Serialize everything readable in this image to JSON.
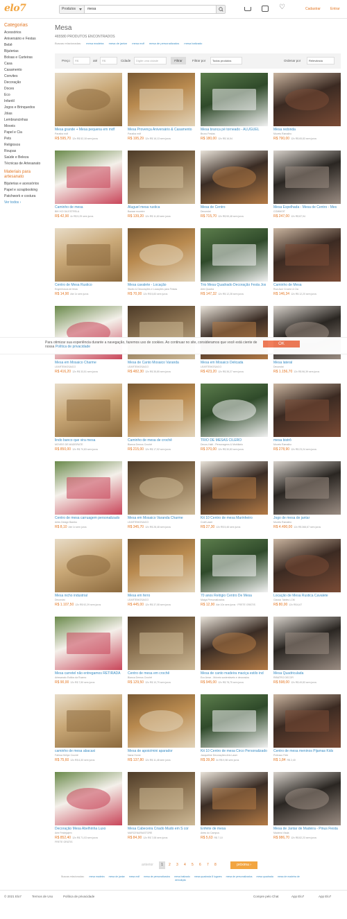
{
  "header": {
    "logo": "elo7",
    "search_category": "Produtos",
    "search_value": "mesa",
    "cadastrar": "Cadastrar",
    "entrar": "Entrar"
  },
  "sidebar": {
    "categories_title": "Categorias",
    "categories": [
      "Acessórios",
      "Aniversário e Festas",
      "Bebê",
      "Bijuterias",
      "Bolsas e Carteiras",
      "Casa",
      "Casamento",
      "Convites",
      "Decoração",
      "Doces",
      "Eco",
      "Infantil",
      "Jogos e Brinquedos",
      "Jóias",
      "Lembrancinhas",
      "Moveis",
      "Papel e Cia",
      "Pets",
      "Religiosos",
      "Roupas",
      "Saúde e Beleza",
      "Técnicas de Artesanato"
    ],
    "materials_title": "Materiais para artesanato",
    "materials": [
      "Bijuterias e acessórios",
      "Papel e scrapbooking",
      "Patchwork e costura"
    ],
    "see_all": "Ver todos ›"
  },
  "main": {
    "title": "Mesa",
    "count": "465580 PRODUTOS ENCONTRADOS",
    "related_tags_label": "Buscas relacionadas:",
    "tags": [
      "mesa madeira",
      "mesa de jantar",
      "mesa mdf",
      "mesa de personalizados",
      "mesa batizado"
    ]
  },
  "filters": {
    "preco": "Preço",
    "de_placeholder": "R$",
    "ate": "até",
    "ate_placeholder": "R$",
    "cidade": "Cidade",
    "cidade_placeholder": "Digite uma cidade",
    "filtrar": "Filtrar",
    "filtrar_por": "Filtrar por",
    "todos": "Todos produtos",
    "ordenar_por": "Ordenar por",
    "relevancia": "Relevância"
  },
  "products": [
    {
      "t": "Mesa grande + Mesa pequena em mdf",
      "s": "Paraiba mdf",
      "p": "R$ 595,70",
      "i": "12x R$ 52,18 sem juros"
    },
    {
      "t": "Mesa Provença Aniversário & Casamento",
      "s": "Paraíba mdf",
      "p": "R$ 195,29",
      "i": "12x R$ 16,13 sem juros"
    },
    {
      "t": "Mesa branca pé torneado - ALUGUEL",
      "s": "Bruno Festas",
      "p": "R$ 180,00",
      "i": "12x R$ 16,54"
    },
    {
      "t": "Mesa redonda",
      "s": "Moveis Ramalho",
      "p": "R$ 790,00",
      "i": "12x R$ 65,83 sem juros"
    },
    {
      "t": "Caminho de mesa",
      "s": "BIKI KO DA ESTRELA",
      "p": "R$ 42,90",
      "i": "4x R$ 5,29 sem juros"
    },
    {
      "t": "Aluguel mesa rustica",
      "s": "Bazaar moveire",
      "p": "R$ 139,20",
      "i": "12x R$ 11,60 sem juros"
    },
    {
      "t": "Mesa de Centro",
      "s": "Decorsist",
      "p": "R$ 715,70",
      "i": "12x R$ 59,48 sem juros"
    },
    {
      "t": "Mesa Espelhada - Mesa de Centro - Mes",
      "s": "COMMOIT",
      "p": "R$ 247,00",
      "i": "12x R$ 87,94"
    },
    {
      "t": "Centro de Mesa Rustico",
      "s": "Engenhosos de fesia",
      "p": "R$ 14,90",
      "i": "Ate 1x sem juros"
    },
    {
      "t": "Mesa cavalete - Locação",
      "s": "Studio & Decorações e Locações para Festas",
      "p": "R$ 70,00",
      "i": "12x R$ 5,83 sem juros"
    },
    {
      "t": "Trio Mesa Quadrado Decoração Festa Jos",
      "s": "Arte Quadra",
      "p": "R$ 147,32",
      "i": "12x R$ 12,28 sem juros"
    },
    {
      "t": "Caminho de Mesa",
      "s": "Rua Azul Croche & Cia",
      "p": "R$ 146,34",
      "i": "12x R$ 12,20 sem juros"
    },
    {
      "t": "Mesa em Mosaico Charme",
      "s": "LEARTEMOSAICO",
      "p": "R$ 416,20",
      "i": "12x R$ 33,51 sem juros"
    },
    {
      "t": "Mesa de Canto Mosaico Varanda",
      "s": "LEARTEMOSAICO",
      "p": "R$ 482,30",
      "i": "12x R$ 35,85 sem juros"
    },
    {
      "t": "Mesa em Mosaico Delicada",
      "s": "LEARTEMOSAICO",
      "p": "R$ 423,20",
      "i": "12x R$ 35,27 sem juros"
    },
    {
      "t": "Mesa lateral",
      "s": "Decorsist",
      "p": "R$ 1.156,70",
      "i": "12x R$ 96,39 sem juros"
    },
    {
      "t": "lindo banco que vira mesa",
      "s": "MOVEIS DE MADEIRATE",
      "p": "R$ 850,00",
      "i": "12x R$ 70,83 sem juros"
    },
    {
      "t": "Caminho de mesa de crochê",
      "s": "Bianca Demos Crochê",
      "p": "R$ 215,00",
      "i": "12x R$ 17,92 sem juros"
    },
    {
      "t": "TRIO DE MESAS CILERO",
      "s": "Decos-Haiti - Personagens & Mobiliário",
      "p": "R$ 370,00",
      "i": "12x R$ 30,83 sem juros"
    },
    {
      "t": "mesa bistrô",
      "s": "Moveis Ramalho",
      "p": "R$ 278,90",
      "i": "12x R$ 23,24 sem juros"
    },
    {
      "t": "Centro de mesa carruagem personalizado",
      "s": "Artes Design Bambo",
      "p": "R$ 8,10",
      "i": "Ate 1x sem juros"
    },
    {
      "t": "Mesa em Mosaico Varanda Charme",
      "s": "LEARTEMOSAICO",
      "p": "R$ 345,70",
      "i": "12x R$ 28,48 sem juros"
    },
    {
      "t": "Kit 10 Centro de mesa Marinheiro",
      "s": "Craft Laser",
      "p": "R$ 27,30",
      "i": "12x R$ 5,46 sem juros"
    },
    {
      "t": "Jogo de mesa de jantar",
      "s": "Moveis Ramalho",
      "p": "R$ 4.490,00",
      "i": "12x R$ 366,67 sem juros"
    },
    {
      "t": "Mesa nicho industrial",
      "s": "Decorsist",
      "p": "R$ 1.107,50",
      "i": "12x R$ 92,29 sem juros"
    },
    {
      "t": "Mesa em ferro",
      "s": "LEARTEMOSAICO",
      "p": "R$ 445,00",
      "i": "12x R$ 37,08 sem juros"
    },
    {
      "t": "70 anos Relógio Centro De Mesa",
      "s": "Malga Personalizados",
      "p": "R$ 12,90",
      "i": "Ate 10x sem juros · FRETE GRÁTIS"
    },
    {
      "t": "Locação de Mesa Rustica Cavalete",
      "s": "Classic Tables LCM",
      "p": "R$ 80,00",
      "i": "12x R$ 6,67"
    },
    {
      "t": "Mesa carretel não entregamos RETIRADA",
      "s": "Artesanato Estilos da Roamo",
      "p": "R$ 90,00",
      "i": "12x R$ 7,50 sem juros"
    },
    {
      "t": "Centro de mesa em crochê",
      "s": "Bianca Demos Crochê",
      "p": "R$ 129,50",
      "i": "12x R$ 10,79 sem juros"
    },
    {
      "t": "Mesa de canto madeira maciça estilo ind",
      "s": "Eco Amar - Móveis sustentáveis e decorados",
      "p": "R$ 945,00",
      "i": "12x R$ 78,75 sem juros"
    },
    {
      "t": "Mesa Quadriculada",
      "s": "RIBATRO DECOR",
      "p": "R$ 598,00",
      "i": "12x R$ 49,83 sem juros"
    },
    {
      "t": "caminho de mesa abacaxi",
      "s": "Fátima Helipe Crochê",
      "p": "R$ 75,60",
      "i": "12x R$ 6,30 sem juros"
    },
    {
      "t": "Mesa de apoio/mini aparador",
      "s": "Nana Home",
      "p": "R$ 137,80",
      "i": "12x R$ 11,48 sem juros"
    },
    {
      "t": "Kit 10 Centro de mesa Circo Personalizado",
      "s": "Jacqueline Decorações Arts Laser",
      "p": "R$ 39,90",
      "i": "4x R$ 9,98 sem juros"
    },
    {
      "t": "Centro de mesa meninos Pijamas Kids",
      "s": "Pretraco Fete",
      "p": "R$ 1,84",
      "i": "R$ 2,40"
    },
    {
      "t": "Decoração Mesa Abelhinha Luxo",
      "s": "Arte Festejajem",
      "p": "R$ 852,40",
      "i": "12x R$ 71,03 sem juros",
      "x": "FRETE GRÁTIS"
    },
    {
      "t": "Mesa Cabeceira Criado Mudo em S cor",
      "s": "MARCENARIASTORE",
      "p": "R$ 84,90",
      "i": "12x R$ 7,08 sem juros"
    },
    {
      "t": "Enfeite de mesa",
      "s": "Artes do Campus",
      "p": "R$ 5,63",
      "i": "R$ 7,10"
    },
    {
      "t": "Mesa de Jantar de Madeira - Pinus Fiesta",
      "s": "Madeira Viada",
      "p": "R$ 986,70",
      "i": "12x R$ 82,23 sem juros"
    }
  ],
  "cookie": {
    "text": "Para otimizar sua experiência durante a navegação, fazemos uso de cookies. Ao continuar no site, consideramos que você está ciente de nossa ",
    "link": "Política de privacidade",
    "ok": "OK"
  },
  "pagination": {
    "prev": "anterior",
    "pages": [
      "1",
      "2",
      "3",
      "4",
      "5",
      "6",
      "7",
      "8"
    ],
    "next": "próxima ›"
  },
  "related": {
    "label": "Buscas relacionadas:",
    "items": [
      "mesa madeira",
      "mesa de jantar",
      "mesa mdf",
      "mesa de personalizados",
      "mesa batizado",
      "mesa quadrada 8 lugares",
      "mesa de personalizados",
      "mesa quadrada",
      "mesa de madeira de demolição"
    ]
  },
  "footer": {
    "copy": "© 2021 Elo7",
    "terms": "Termos de Uso",
    "privacy": "Política de privacidade",
    "buy_chat": "Compre pelo Chat",
    "app1": "App Elo7",
    "app2": "App Elo7"
  }
}
